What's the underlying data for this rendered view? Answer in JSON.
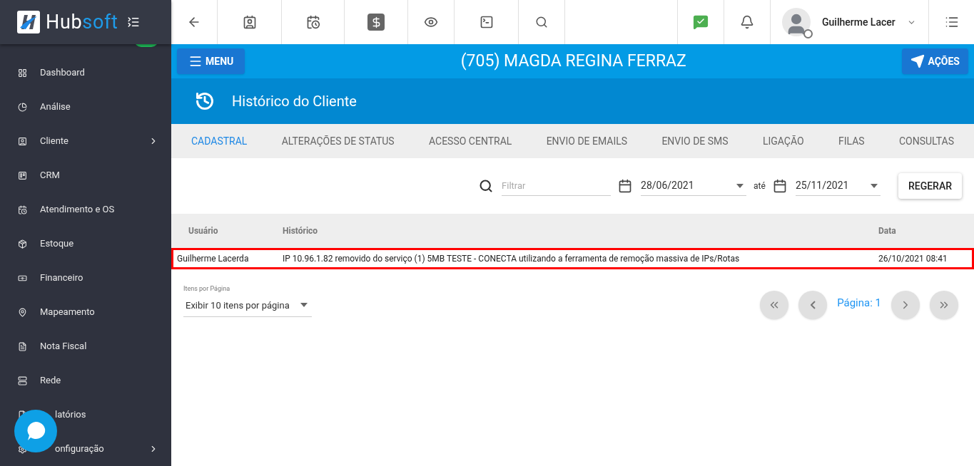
{
  "brand": {
    "name_dark": "Hub",
    "name_accent": "soft"
  },
  "sidebar": {
    "items": [
      {
        "label": "Dashboard",
        "has_submenu": false
      },
      {
        "label": "Análise",
        "has_submenu": false
      },
      {
        "label": "Cliente",
        "has_submenu": true
      },
      {
        "label": "CRM",
        "has_submenu": false
      },
      {
        "label": "Atendimento e OS",
        "has_submenu": false
      },
      {
        "label": "Estoque",
        "has_submenu": false
      },
      {
        "label": "Financeiro",
        "has_submenu": false
      },
      {
        "label": "Mapeamento",
        "has_submenu": false
      },
      {
        "label": "Nota Fiscal",
        "has_submenu": false
      },
      {
        "label": "Rede",
        "has_submenu": false
      },
      {
        "label": "latórios",
        "has_submenu": false,
        "covered": true
      },
      {
        "label": "onfiguração",
        "has_submenu": true,
        "covered": true
      }
    ]
  },
  "topbar": {
    "user_name": "Guilherme Lacer"
  },
  "client_bar": {
    "menu_button": "MENU",
    "title": "(705) MAGDA REGINA FERRAZ",
    "actions_button": "AÇÕES"
  },
  "page_header": {
    "title": "Histórico do Cliente"
  },
  "tabs": [
    {
      "label": "CADASTRAL",
      "selected": true
    },
    {
      "label": "ALTERAÇÕES DE STATUS",
      "selected": false
    },
    {
      "label": "ACESSO CENTRAL",
      "selected": false
    },
    {
      "label": "ENVIO DE EMAILS",
      "selected": false
    },
    {
      "label": "ENVIO DE SMS",
      "selected": false
    },
    {
      "label": "LIGAÇÃO",
      "selected": false
    },
    {
      "label": "FILAS",
      "selected": false
    },
    {
      "label": "CONSULTAS",
      "selected": false
    }
  ],
  "filters": {
    "search_placeholder": "Filtrar",
    "date_from": "28/06/2021",
    "between": "até",
    "date_to": "25/11/2021",
    "regenerate_button": "REGERAR"
  },
  "table": {
    "columns": [
      "Usuário",
      "Histórico",
      "Data"
    ],
    "rows": [
      {
        "cells": [
          "Guilherme Lacerda",
          "IP 10.96.1.82 removido do serviço (1) 5MB TESTE - CONECTA utilizando a ferramenta de remoção massiva de IPs/Rotas",
          "26/10/2021 08:41"
        ],
        "highlighted": true
      }
    ]
  },
  "pagination": {
    "page_size_label": "Itens por Página",
    "page_size_value": "Exibir 10 itens por página",
    "page_label": "Página: 1"
  }
}
